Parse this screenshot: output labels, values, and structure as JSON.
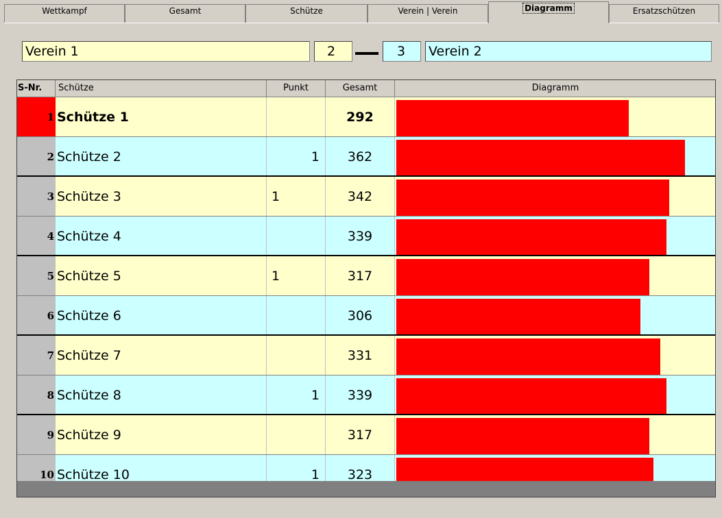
{
  "tabs": [
    {
      "label": "Wettkampf",
      "active": false
    },
    {
      "label": "Gesamt",
      "active": false
    },
    {
      "label": "Schütze",
      "active": false
    },
    {
      "label": "Verein | Verein",
      "active": false
    },
    {
      "label": "Diagramm",
      "active": true
    },
    {
      "label": "Ersatzschützen",
      "active": false
    }
  ],
  "match": {
    "team_left": "Verein 1",
    "score_left": "2",
    "score_right": "3",
    "team_right": "Verein 2"
  },
  "table": {
    "headers": {
      "nr": "S-Nr.",
      "name": "Schütze",
      "punkt": "Punkt",
      "gesamt": "Gesamt",
      "diagramm": "Diagramm"
    },
    "rows": [
      {
        "nr": "1",
        "name": "Schütze 1",
        "punkt": "",
        "gesamt": "292"
      },
      {
        "nr": "2",
        "name": "Schütze 2",
        "punkt": "1",
        "gesamt": "362"
      },
      {
        "nr": "3",
        "name": "Schütze 3",
        "punkt": "1",
        "gesamt": "342"
      },
      {
        "nr": "4",
        "name": "Schütze 4",
        "punkt": "",
        "gesamt": "339"
      },
      {
        "nr": "5",
        "name": "Schütze 5",
        "punkt": "1",
        "gesamt": "317"
      },
      {
        "nr": "6",
        "name": "Schütze 6",
        "punkt": "",
        "gesamt": "306"
      },
      {
        "nr": "7",
        "name": "Schütze 7",
        "punkt": "",
        "gesamt": "331"
      },
      {
        "nr": "8",
        "name": "Schütze 8",
        "punkt": "1",
        "gesamt": "339"
      },
      {
        "nr": "9",
        "name": "Schütze 9",
        "punkt": "",
        "gesamt": "317"
      },
      {
        "nr": "10",
        "name": "Schütze 10",
        "punkt": "1",
        "gesamt": "323"
      }
    ]
  },
  "colors": {
    "team_left_bg": "#ffffcc",
    "team_right_bg": "#ccffff",
    "bar": "#ff0000",
    "selected_nr": "#ff0000"
  }
}
